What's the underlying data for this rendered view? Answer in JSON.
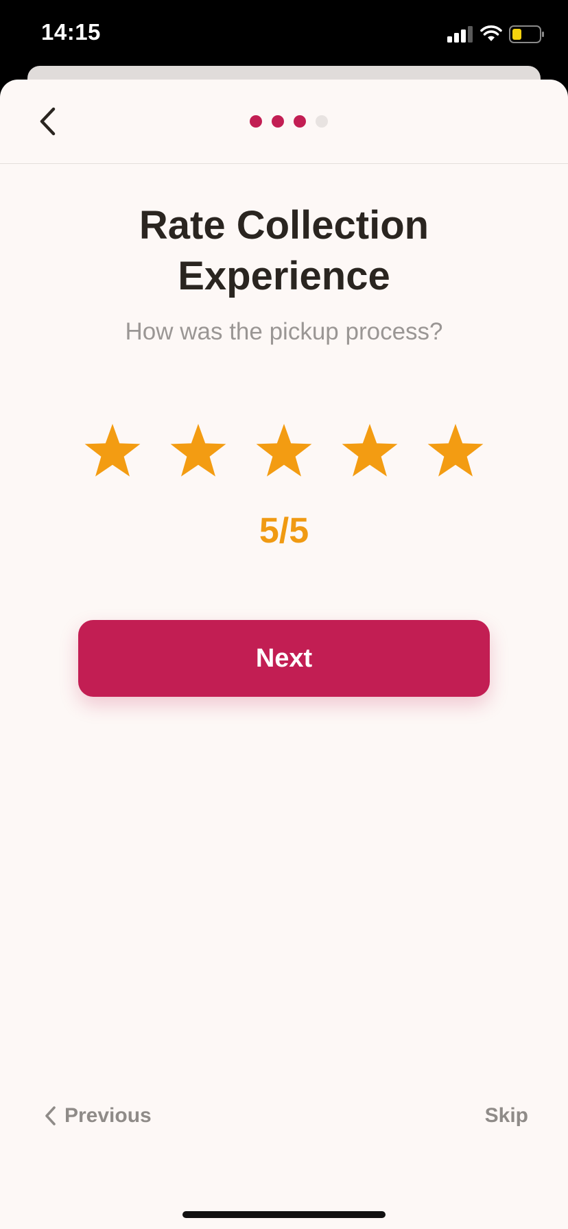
{
  "status_bar": {
    "time": "14:15",
    "icons": [
      "signal-icon",
      "wifi-icon",
      "battery-icon"
    ]
  },
  "header": {
    "back_icon": "chevron-left-icon",
    "progress": {
      "total_steps": 4,
      "current_step": 3
    }
  },
  "content": {
    "title_line1": "Rate Collection",
    "title_line2": "Experience",
    "subtitle": "How was the pickup process?",
    "rating": {
      "max": 5,
      "value": 5,
      "label": "5/5"
    },
    "next_label": "Next"
  },
  "footer": {
    "previous_label": "Previous",
    "skip_label": "Skip"
  },
  "colors": {
    "accent": "#c21e53",
    "star": "#f39c12",
    "rating_text": "#f09a12",
    "background": "#fdf8f6",
    "title": "#2a2520",
    "muted": "#9a9694"
  }
}
